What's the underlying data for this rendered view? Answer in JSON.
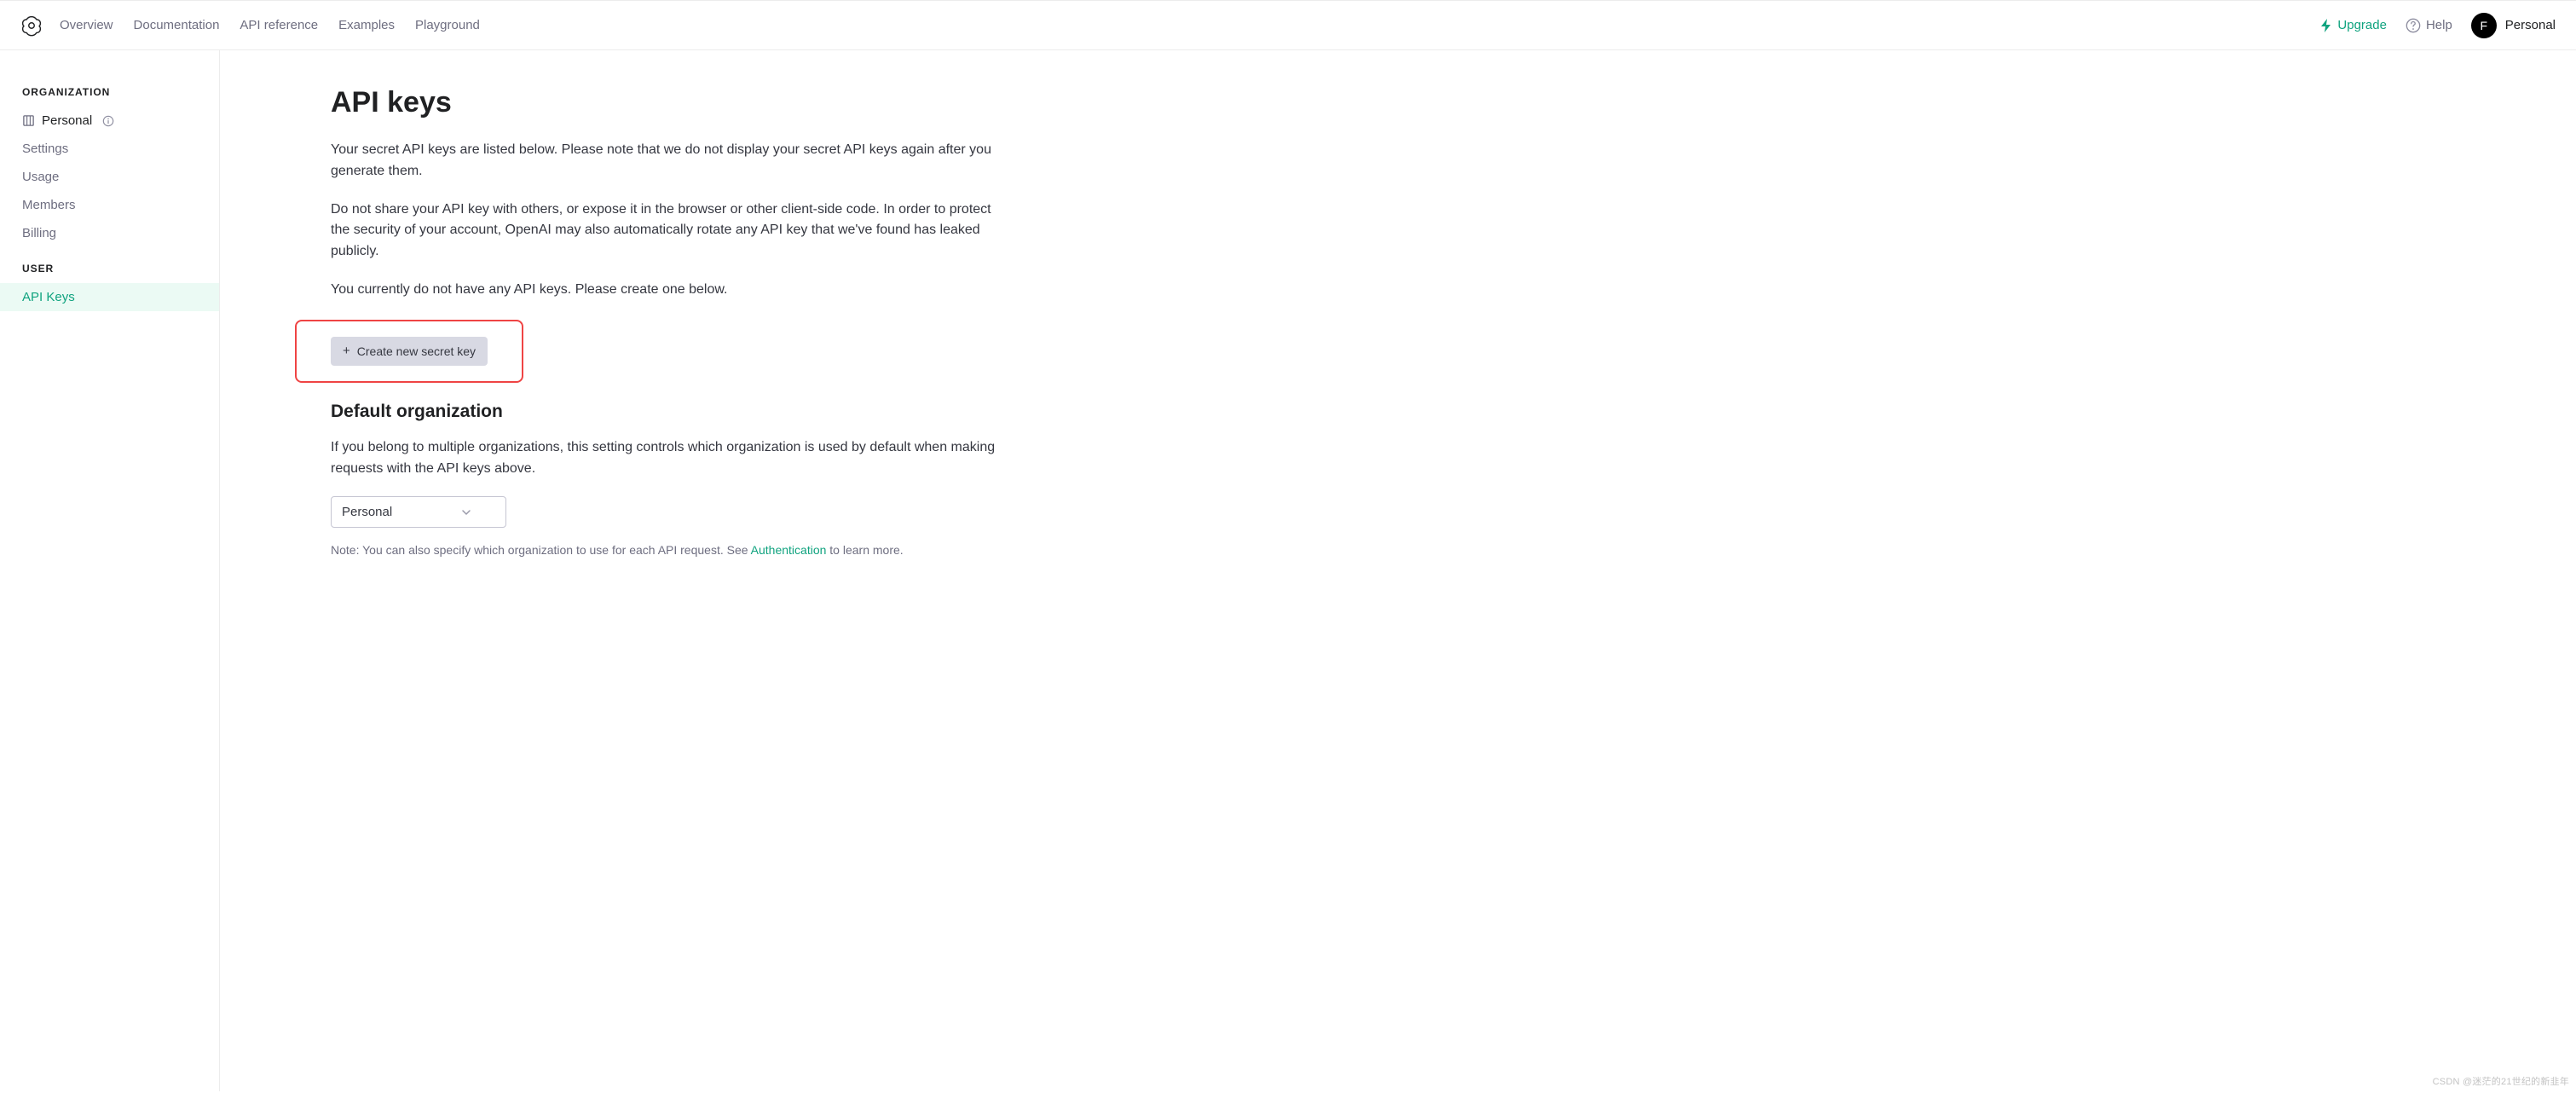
{
  "header": {
    "nav": [
      "Overview",
      "Documentation",
      "API reference",
      "Examples",
      "Playground"
    ],
    "upgrade_label": "Upgrade",
    "help_label": "Help",
    "avatar_initial": "F",
    "avatar_label": "Personal"
  },
  "sidebar": {
    "section_org": "ORGANIZATION",
    "org_name": "Personal",
    "org_items": [
      "Settings",
      "Usage",
      "Members",
      "Billing"
    ],
    "section_user": "USER",
    "user_items": [
      "API Keys"
    ]
  },
  "main": {
    "title": "API keys",
    "p1": "Your secret API keys are listed below. Please note that we do not display your secret API keys again after you generate them.",
    "p2": "Do not share your API key with others, or expose it in the browser or other client-side code. In order to protect the security of your account, OpenAI may also automatically rotate any API key that we've found has leaked publicly.",
    "p3": "You currently do not have any API keys. Please create one below.",
    "create_btn": "Create new secret key",
    "default_org_heading": "Default organization",
    "default_org_p": "If you belong to multiple organizations, this setting controls which organization is used by default when making requests with the API keys above.",
    "select_value": "Personal",
    "note_prefix": "Note: You can also specify which organization to use for each API request. See ",
    "note_link": "Authentication",
    "note_suffix": " to learn more."
  },
  "watermark": "CSDN @迷茫的21世纪的新韭年"
}
